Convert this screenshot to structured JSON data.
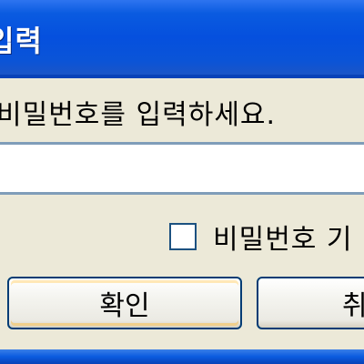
{
  "window": {
    "title": "입력"
  },
  "prompt": {
    "label": "비밀번호를 입력하세요."
  },
  "password_field": {
    "value": ""
  },
  "remember_checkbox": {
    "label": "비밀번호 기",
    "checked": false
  },
  "buttons": {
    "ok_label": "확인",
    "cancel_label": "취"
  },
  "colors": {
    "titlebar": "#0550de",
    "background": "#ece9d8",
    "button_border": "#003c74"
  }
}
